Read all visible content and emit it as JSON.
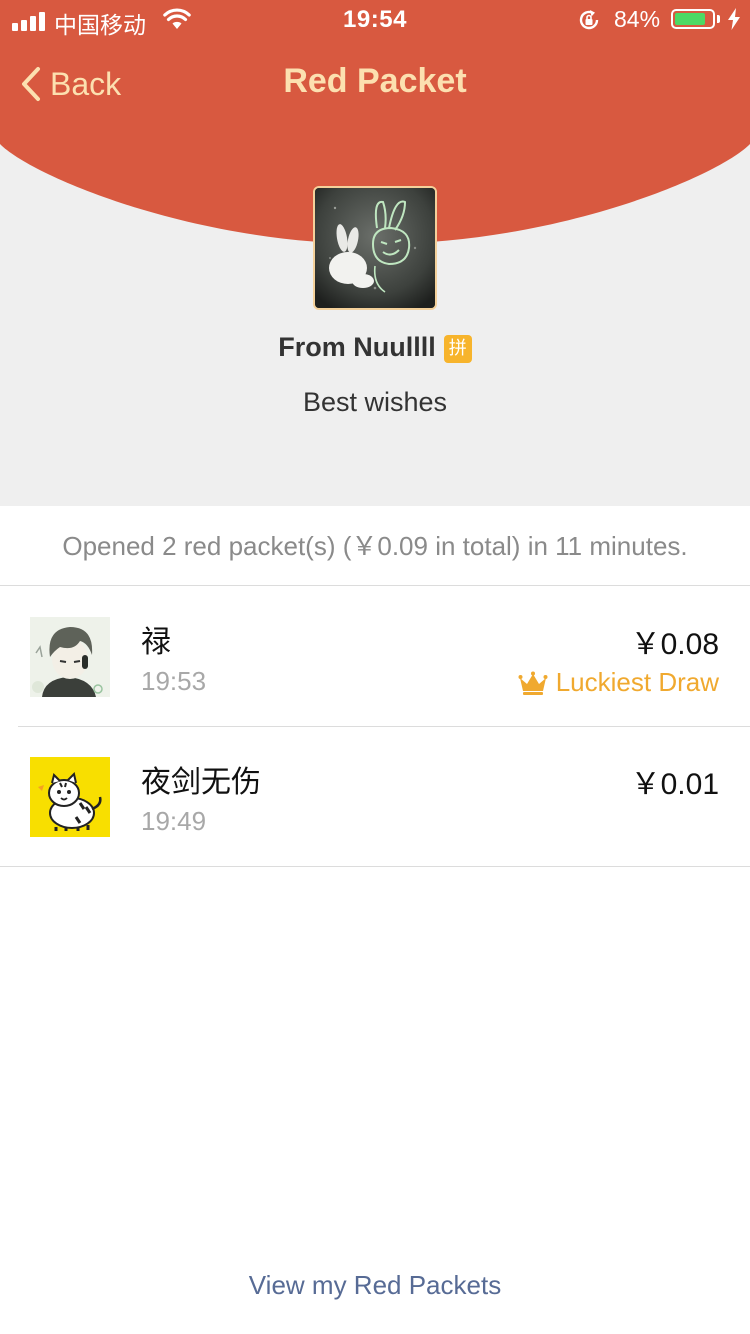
{
  "status_bar": {
    "carrier": "中国移动",
    "time": "19:54",
    "battery_percent": "84%",
    "battery_level": 0.84,
    "icons": [
      "signal-icon",
      "wifi-icon",
      "orientation-lock-icon",
      "battery-icon",
      "charging-bolt-icon"
    ]
  },
  "nav": {
    "back_label": "Back",
    "title": "Red Packet"
  },
  "packet": {
    "from": "From Nuullll",
    "badge": "拼",
    "message": "Best wishes"
  },
  "summary": "Opened 2 red packet(s) (￥0.09 in total) in 11 minutes.",
  "records": [
    {
      "name": "禄",
      "time": "19:53",
      "amount": "￥0.08",
      "luckiest_label": "Luckiest Draw",
      "luckiest_icon": "crown-icon"
    },
    {
      "name": "夜剑无伤",
      "time": "19:49",
      "amount": "￥0.01"
    }
  ],
  "footer": {
    "link": "View my Red Packets"
  },
  "colors": {
    "header_red": "#D85940",
    "header_text": "#FCE0B0",
    "gold": "#F0A92F",
    "link_blue": "#576B95",
    "background_grey": "#EFEFEF"
  }
}
